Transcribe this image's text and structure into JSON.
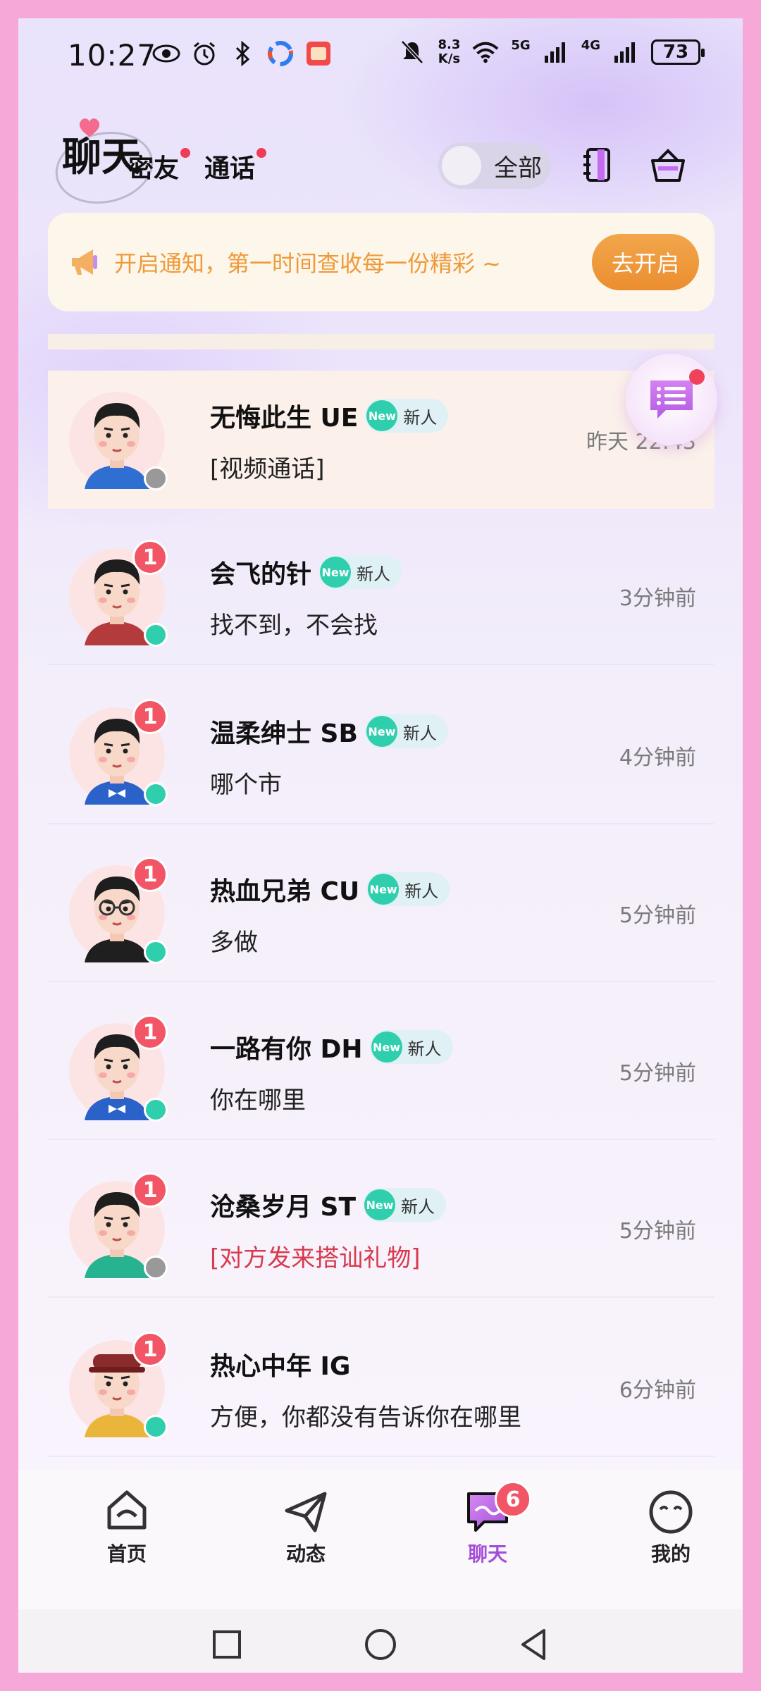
{
  "status_bar": {
    "time": "10:27",
    "net_speed_value": "8.3",
    "net_speed_unit": "K/s",
    "network_1": "5G",
    "network_2": "4G",
    "battery": "73"
  },
  "header": {
    "title": "聊天",
    "tabs": [
      {
        "label": "密友",
        "has_dot": true
      },
      {
        "label": "通话",
        "has_dot": true
      }
    ],
    "filter_toggle_label": "全部"
  },
  "notice": {
    "text": "开启通知，第一时间查收每一份精彩 ~",
    "button": "去开启"
  },
  "conversations": [
    {
      "name": "无悔此生 UE",
      "badge_new": "New",
      "badge_label": "新人",
      "preview": "[视频通话]",
      "time": "昨天 22:43",
      "unread": "",
      "online": false,
      "pinned": true,
      "preview_type": "normal"
    },
    {
      "name": "会飞的针",
      "badge_new": "New",
      "badge_label": "新人",
      "preview": "找不到，不会找",
      "time": "3分钟前",
      "unread": "1",
      "online": true,
      "pinned": false,
      "preview_type": "normal"
    },
    {
      "name": "温柔绅士 SB",
      "badge_new": "New",
      "badge_label": "新人",
      "preview": "哪个市",
      "time": "4分钟前",
      "unread": "1",
      "online": true,
      "pinned": false,
      "preview_type": "normal"
    },
    {
      "name": "热血兄弟 CU",
      "badge_new": "New",
      "badge_label": "新人",
      "preview": "多做",
      "time": "5分钟前",
      "unread": "1",
      "online": true,
      "pinned": false,
      "preview_type": "normal"
    },
    {
      "name": "一路有你 DH",
      "badge_new": "New",
      "badge_label": "新人",
      "preview": "你在哪里",
      "time": "5分钟前",
      "unread": "1",
      "online": true,
      "pinned": false,
      "preview_type": "normal"
    },
    {
      "name": "沧桑岁月 ST",
      "badge_new": "New",
      "badge_label": "新人",
      "preview": "[对方发来搭讪礼物]",
      "time": "5分钟前",
      "unread": "1",
      "online": false,
      "pinned": false,
      "preview_type": "gift"
    },
    {
      "name": "热心中年 IG",
      "badge_new": "",
      "badge_label": "",
      "preview": "方便，你都没有告诉你在哪里",
      "time": "6分钟前",
      "unread": "1",
      "online": true,
      "pinned": false,
      "preview_type": "normal"
    }
  ],
  "bottom_nav": {
    "items": [
      {
        "label": "首页",
        "icon": "home-icon"
      },
      {
        "label": "动态",
        "icon": "paper-plane-icon"
      },
      {
        "label": "聊天",
        "icon": "chat-icon",
        "badge": "6",
        "active": true
      },
      {
        "label": "我的",
        "icon": "face-icon"
      }
    ]
  },
  "colors": {
    "accent_purple": "#a44fd8",
    "badge_red": "#f15566",
    "online_green": "#2fcfae",
    "offline_gray": "#999999",
    "notice_orange": "#ef9a3a"
  }
}
